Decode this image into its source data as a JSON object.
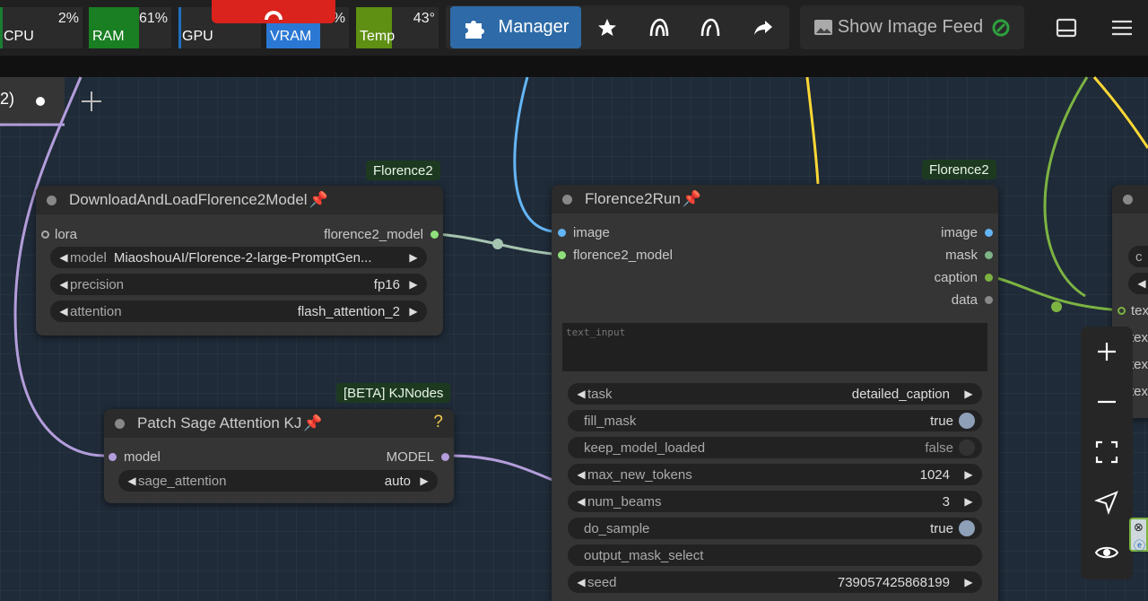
{
  "monitors": {
    "cpu": {
      "label": "CPU",
      "pct": "2%",
      "fraction": 0.02
    },
    "ram": {
      "label": "RAM",
      "pct": "61%",
      "fraction": 0.61
    },
    "gpu": {
      "label": "GPU",
      "pct": ""
    },
    "vram": {
      "label": "VRAM",
      "pct": "%"
    },
    "temp": {
      "label": "Temp",
      "pct": "43°"
    }
  },
  "toolbar": {
    "manager_label": "Manager",
    "show_feed_label": "Show Image Feed"
  },
  "tab": {
    "label": "2)"
  },
  "colors": {
    "accent": "#2b7ad8",
    "badge_bg": "#1d3a20",
    "wire_image": "#64b5f6",
    "wire_model": "#b39ddb",
    "wire_string": "#7cb342",
    "wire_yellow": "#fdd835",
    "wire_florence": "#a5c4b0"
  },
  "nodes": {
    "download": {
      "badge": "Florence2",
      "title": "DownloadAndLoadFlorence2Model",
      "input_lora": "lora",
      "output": "florence2_model",
      "widgets": [
        {
          "name": "model",
          "value": "MiaoshouAI/Florence-2-large-PromptGen..."
        },
        {
          "name": "precision",
          "value": "fp16"
        },
        {
          "name": "attention",
          "value": "flash_attention_2"
        }
      ]
    },
    "patch": {
      "badge": "[BETA] KJNodes",
      "title": "Patch Sage Attention KJ",
      "help": "?",
      "input": "model",
      "output": "MODEL",
      "widgets": [
        {
          "name": "sage_attention",
          "value": "auto"
        }
      ]
    },
    "run": {
      "badge": "Florence2",
      "title": "Florence2Run",
      "inputs": [
        "image",
        "florence2_model"
      ],
      "outputs": [
        "image",
        "mask",
        "caption",
        "data"
      ],
      "text_placeholder": "text_input",
      "widgets": [
        {
          "name": "task",
          "value": "detailed_caption"
        },
        {
          "name": "fill_mask",
          "value": "true"
        },
        {
          "name": "keep_model_loaded",
          "value": "false"
        },
        {
          "name": "max_new_tokens",
          "value": "1024"
        },
        {
          "name": "num_beams",
          "value": "3"
        },
        {
          "name": "do_sample",
          "value": "true"
        },
        {
          "name": "output_mask_select",
          "value": ""
        },
        {
          "name": "seed",
          "value": "739057425868199"
        }
      ]
    },
    "partial": {
      "inputs": [
        "tex",
        "tex",
        "tex",
        "tex"
      ],
      "widget_stub": "c"
    }
  }
}
